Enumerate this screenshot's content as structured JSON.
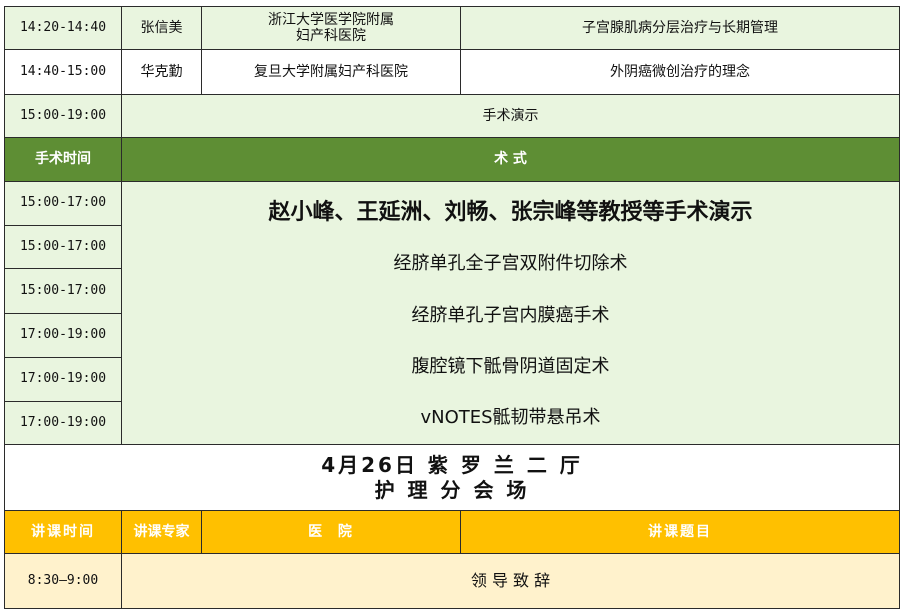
{
  "top_rows": [
    {
      "time": "14:20-14:40",
      "speaker": "张信美",
      "hospital": "浙江大学医学院附属\n妇产科医院",
      "topic": "子宫腺肌病分层治疗与长期管理"
    },
    {
      "time": "14:40-15:00",
      "speaker": "华克勤",
      "hospital": "复旦大学附属妇产科医院",
      "topic": "外阴癌微创治疗的理念"
    }
  ],
  "demo_row": {
    "time": "15:00-19:00",
    "label": "手术演示"
  },
  "surgery_header": {
    "time_label": "手术时间",
    "type_label": "术 式"
  },
  "surgery_times": [
    "15:00-17:00",
    "15:00-17:00",
    "15:00-17:00",
    "17:00-19:00",
    "17:00-19:00",
    "17:00-19:00"
  ],
  "surgery_lines": [
    "赵小峰、王延洲、刘畅、张宗峰等教授等手术演示",
    "经脐单孔全子宫双附件切除术",
    "经脐单孔子宫内膜癌手术",
    "腹腔镜下骶骨阴道固定术",
    "vNOTES骶韧带悬吊术"
  ],
  "venue": {
    "line1": "4月26日 紫 罗 兰 二 厅",
    "line2": "护 理 分 会 场"
  },
  "lecture_header": {
    "time": "讲课时间",
    "expert": "讲课专家",
    "hospital": "医  院",
    "topic": "讲课题目"
  },
  "lecture_rows": [
    {
      "time": "8:30—9:00",
      "content": "领 导 致 辞"
    }
  ],
  "colors": {
    "green_header": "#5e8e34",
    "mint_fill": "#e9f5df",
    "gold_header": "#ffc000",
    "cream_fill": "#fff2cc"
  }
}
